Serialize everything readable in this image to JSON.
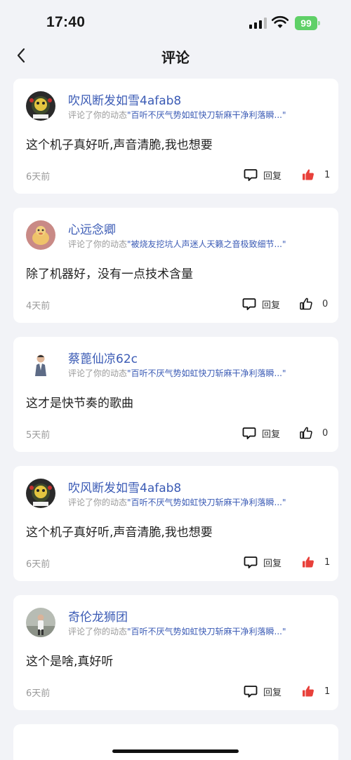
{
  "status_bar": {
    "time": "17:40",
    "battery": "99",
    "battery_color": "#5fd067"
  },
  "nav": {
    "title": "评论",
    "back_icon": "chevron-left-icon"
  },
  "comments": [
    {
      "username": "吹风断发如雪4afab8",
      "action": "评论了你的动态",
      "post": "\"百听不厌气势如虹快刀斩麻干净利落瞬...\"",
      "text": "这个机子真好听,声音清脆,我也想要",
      "time": "6天前",
      "reply": "回复",
      "likes": "1",
      "liked": true
    },
    {
      "username": "心远念卿",
      "action": "评论了你的动态",
      "post": "\"被烧友挖坑人声迷人天籁之音极致细节...\"",
      "text": "除了机器好，没有一点技术含量",
      "time": "4天前",
      "reply": "回复",
      "likes": "0",
      "liked": false
    },
    {
      "username": "蔡蓖仙凉62c",
      "action": "评论了你的动态",
      "post": "\"百听不厌气势如虹快刀斩麻干净利落瞬...\"",
      "text": "这才是快节奏的歌曲",
      "time": "5天前",
      "reply": "回复",
      "likes": "0",
      "liked": false
    },
    {
      "username": "吹风断发如雪4afab8",
      "action": "评论了你的动态",
      "post": "\"百听不厌气势如虹快刀斩麻干净利落瞬...\"",
      "text": "这个机子真好听,声音清脆,我也想要",
      "time": "6天前",
      "reply": "回复",
      "likes": "1",
      "liked": true
    },
    {
      "username": "奇伦龙狮团",
      "action": "评论了你的动态",
      "post": "\"百听不厌气势如虹快刀斩麻干净利落瞬...\"",
      "text": "这个是啥,真好听",
      "time": "6天前",
      "reply": "回复",
      "likes": "1",
      "liked": true
    }
  ],
  "colors": {
    "accent_blue": "#3b5bb5",
    "like_red": "#e8403a"
  }
}
